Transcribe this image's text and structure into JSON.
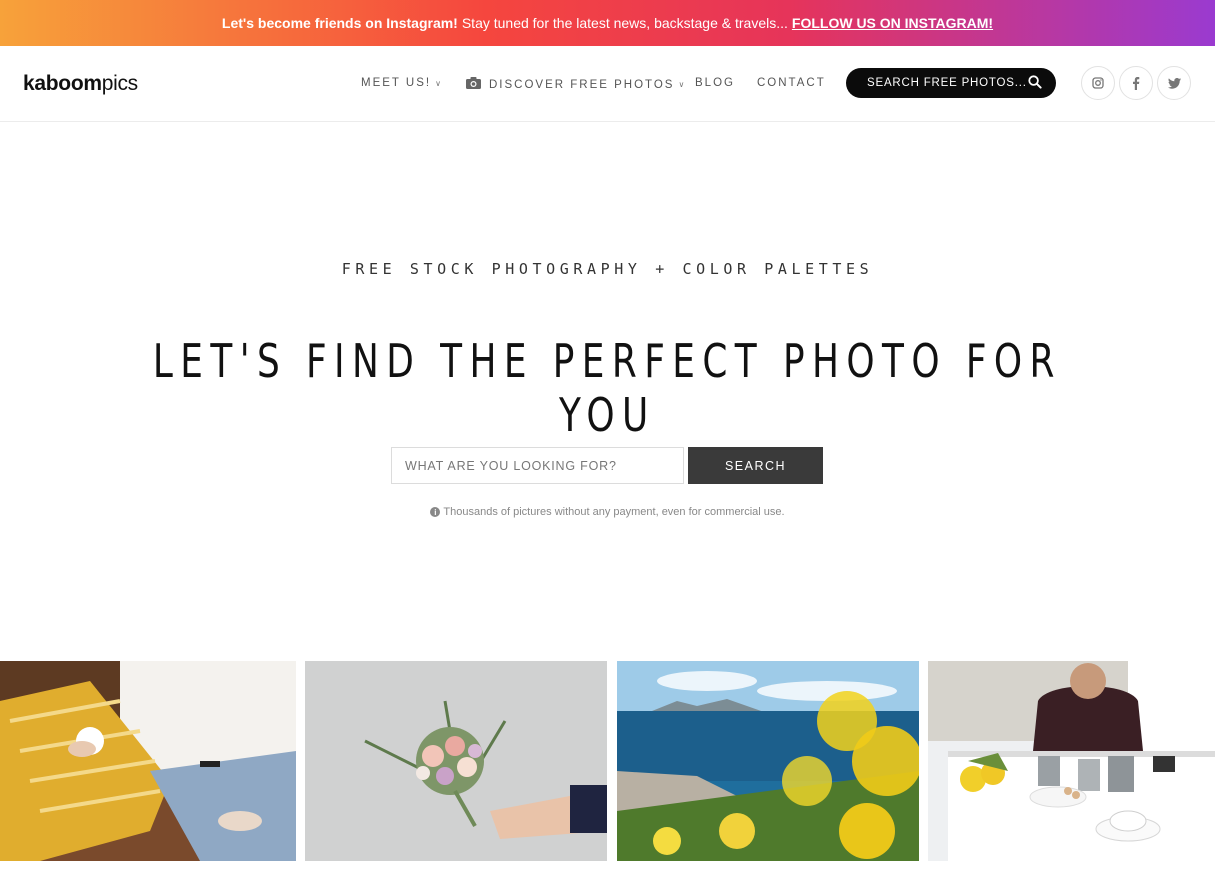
{
  "promo": {
    "bold": "Let's become friends on Instagram!",
    "text": "Stay tuned for the latest news, backstage & travels...",
    "link": "FOLLOW US ON INSTAGRAM!"
  },
  "header": {
    "logo_bold": "kaboom",
    "logo_light": "pics",
    "nav": {
      "meet_us": "MEET US!",
      "discover": "DISCOVER FREE PHOTOS",
      "blog": "BLOG",
      "contact": "CONTACT"
    },
    "search_label": "SEARCH FREE PHOTOS...",
    "social_icons": [
      "instagram-icon",
      "facebook-icon",
      "twitter-icon"
    ]
  },
  "hero": {
    "kicker": "FREE STOCK PHOTOGRAPHY + COLOR PALETTES",
    "headline": "LET'S FIND THE PERFECT PHOTO FOR YOU",
    "search_placeholder": "WHAT ARE YOU LOOKING FOR?",
    "search_button": "SEARCH",
    "note": "Thousands of pictures without any payment, even for commercial use."
  },
  "colors": {
    "promo_gradient": [
      "#f7a23a",
      "#f5463e",
      "#e6345a",
      "#9a3ad0"
    ],
    "header_search_bg": "#0b0b0b",
    "search_button_bg": "#3a3a3a"
  },
  "photos": [
    {
      "subject": "woman-with-coffee-on-yellow-blanket"
    },
    {
      "subject": "flower-bouquet-on-gray"
    },
    {
      "subject": "sea-coast-with-yellow-flowers"
    },
    {
      "subject": "man-at-table-with-tea-and-lemons"
    }
  ]
}
